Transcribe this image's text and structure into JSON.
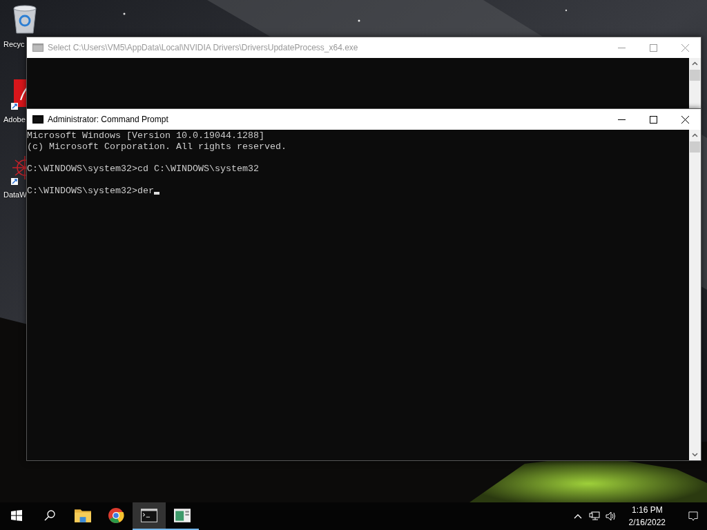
{
  "desktop": {
    "icons": [
      {
        "kind": "recycle-bin",
        "label": "Recyc"
      },
      {
        "kind": "pdf",
        "label": "Adobe"
      },
      {
        "kind": "web",
        "label": "DataW"
      }
    ]
  },
  "windows": [
    {
      "title": "Select C:\\Users\\VM5\\AppData\\Local\\NVIDIA Drivers\\DriversUpdateProcess_x64.exe",
      "active": false
    },
    {
      "title": "Administrator: Command Prompt",
      "active": true,
      "paragraphs": [
        [
          "Microsoft Windows [Version 10.0.19044.1288]",
          "(c) Microsoft Corporation. All rights reserved."
        ],
        [
          "C:\\WINDOWS\\system32>cd C:\\WINDOWS\\system32"
        ],
        [
          "C:\\WINDOWS\\system32>der"
        ]
      ],
      "cursor": true
    }
  ],
  "taskbar": {
    "buttons": [
      {
        "kind": "start",
        "active": false,
        "open": false
      },
      {
        "kind": "search",
        "active": false,
        "open": false
      },
      {
        "kind": "folder",
        "active": false,
        "open": false
      },
      {
        "kind": "browser",
        "active": false,
        "open": false
      },
      {
        "kind": "console",
        "active": true,
        "open": true
      },
      {
        "kind": "app",
        "active": false,
        "open": true
      }
    ],
    "time": "1:16 PM",
    "date": "2/16/2022"
  }
}
